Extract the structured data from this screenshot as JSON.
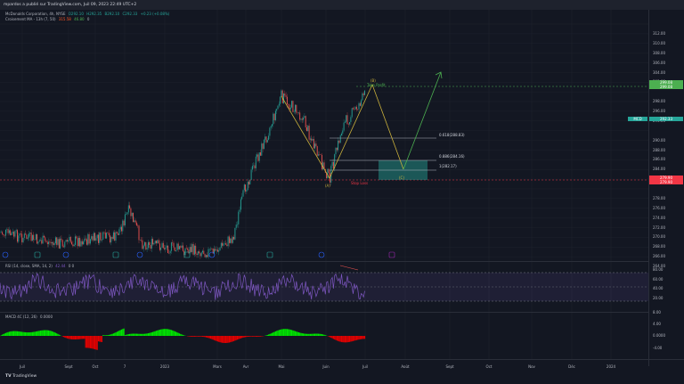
{
  "header": {
    "publisher_line": "mpardos a publié sur TradingView.com, Juil 09, 2023 22:49 UTC+2"
  },
  "legend": {
    "symbol": "McDonalds Corporation, 4h, NYSE",
    "open": "O292.10",
    "high": "H292.35",
    "low": "B292.10",
    "close": "C292.33",
    "change": "+0.23 (+0.08%)",
    "indicator": "Croisement MA - 13h (7, 50)",
    "ind_v1": "315.58",
    "ind_v2": "46.80",
    "ind_v3": "0"
  },
  "rsi": {
    "label": "RSI (14, close, SMA, 14, 2)",
    "value": "42.44",
    "extra": "0 0",
    "ticks": [
      "80.00",
      "60.00",
      "40.00",
      "20.00"
    ]
  },
  "macd": {
    "label": "MACD 4C (12, 26)",
    "value": "0.0000",
    "ticks": [
      "8.00",
      "4.00",
      "0.0000",
      "-4.00"
    ]
  },
  "price_axis": {
    "ticks": [
      "312.00",
      "310.00",
      "308.00",
      "306.00",
      "304.00",
      "302.00",
      "298.00",
      "296.00",
      "294.00",
      "290.00",
      "288.00",
      "286.00",
      "284.00",
      "282.00",
      "278.00",
      "276.00",
      "274.00",
      "272.00",
      "270.00",
      "268.00",
      "266.00",
      "264.00"
    ],
    "take_profit_tag": "299.08",
    "take_profit_tag2": "299.08",
    "symbol_tag": "MCD",
    "last_price": "292.33",
    "stop_tag": "279.90",
    "stop_tag2": "279.90"
  },
  "annotations": {
    "wave_a": "(A)",
    "wave_b": "(B)",
    "wave_c": "(C)",
    "take_profit": "Take Profit",
    "stop_loss": "Stop Loss",
    "fib_618": "0.618(288.83)",
    "fib_886": "0.886(284.16)",
    "fib_1": "1(282.17)"
  },
  "time_axis": [
    "Juil",
    "Sept",
    "Oct",
    "7",
    "2023",
    "Mars",
    "Avr",
    "Mai",
    "Juin",
    "Juil",
    "Août",
    "Sept",
    "Oct",
    "Nov",
    "Déc",
    "2024"
  ],
  "footer": {
    "brand": "TradingView"
  },
  "colors": {
    "up": "#26a69a",
    "down": "#ef5350",
    "wave": "#c9b03c",
    "projection": "#4caf50",
    "stop": "#f23645",
    "take": "#4caf50",
    "rsi": "#7e57c2"
  }
}
